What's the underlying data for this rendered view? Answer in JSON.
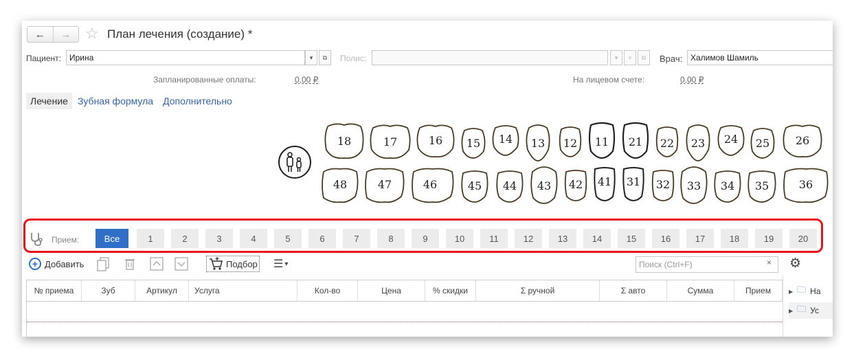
{
  "window": {
    "title": "План лечения (создание) *",
    "back_glyph": "←",
    "forward_glyph": "→"
  },
  "patient": {
    "label": "Пациент:",
    "value": "Ирина"
  },
  "policy": {
    "label": "Полис:",
    "value": ""
  },
  "doctor": {
    "label": "Врач:",
    "value": "Халимов Шамиль"
  },
  "payments": {
    "planned_label": "Запланированные оплаты:",
    "planned_value": "0,00 ₽",
    "account_label": "На лицевом счете:",
    "account_value": "0,00 ₽"
  },
  "tabs": [
    "Лечение",
    "Зубная формула",
    "Дополнительно"
  ],
  "teeth": {
    "upper": [
      "18",
      "17",
      "16",
      "15",
      "14",
      "13",
      "12",
      "11",
      "21",
      "22",
      "23",
      "24",
      "25",
      "26"
    ],
    "lower": [
      "48",
      "47",
      "46",
      "45",
      "44",
      "43",
      "42",
      "41",
      "31",
      "32",
      "33",
      "34",
      "35",
      "36"
    ]
  },
  "visits": {
    "label": "Прием:",
    "all_label": "Все",
    "items": [
      "1",
      "2",
      "3",
      "4",
      "5",
      "6",
      "7",
      "8",
      "9",
      "10",
      "11",
      "12",
      "13",
      "14",
      "15",
      "16",
      "17",
      "18",
      "19",
      "20"
    ],
    "selected": "Все"
  },
  "toolbar": {
    "add_label": "Добавить",
    "pick_label": "Подбор",
    "search_placeholder": "Поиск (Ctrl+F)"
  },
  "table": {
    "columns": [
      "№ приема",
      "Зуб",
      "Артикул",
      "Услуга",
      "Кол-во",
      "Цена",
      "% скидки",
      "Σ ручной",
      "Σ авто",
      "Сумма",
      "Прием"
    ]
  },
  "tree": {
    "items": [
      "На",
      "Ус"
    ]
  },
  "colors": {
    "accent": "#2f6fc8",
    "highlight": "#e8121b",
    "link": "#3565a8"
  }
}
